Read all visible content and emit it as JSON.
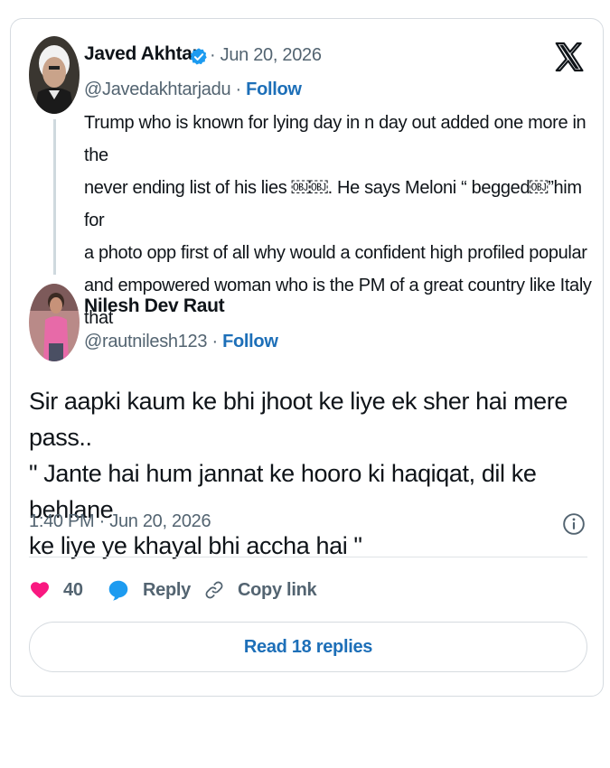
{
  "original_tweet": {
    "author_name": "Javed Akhtar",
    "date": " · Jun 20, 2026",
    "handle": "@Javedakhtarjadu · ",
    "follow_label": "Follow",
    "text": "Trump who is known for lying day in n day out added one more in the\nnever ending list of his lies ￼￼. He says Meloni “ begged￼”him for\na photo opp first of all why would a confident  high profiled popular\nand empowered woman  who is the PM of a great  country like Italy\nthat"
  },
  "reply_tweet": {
    "author_name": "Nilesh Dev Raut",
    "handle": "@rautnilesh123 · ",
    "follow_label": "Follow",
    "text": "Sir aapki kaum ke bhi jhoot ke liye ek sher hai mere pass..\n\" Jante hai hum jannat ke hooro ki haqiqat, dil ke behlane\nke liye ye khayal bhi accha hai \"",
    "timestamp": "1:40 PM · Jun 20, 2026"
  },
  "actions": {
    "like_count": "40",
    "reply_label": "Reply",
    "copy_link_label": "Copy link"
  },
  "read_replies_label": "Read 18 replies",
  "colors": {
    "accent": "#1d9bf0",
    "link": "#1d6fb8",
    "like": "#f91880",
    "muted": "#536471"
  },
  "icons": [
    "x-logo-icon",
    "verified-badge-icon",
    "info-icon",
    "heart-icon",
    "reply-bubble-icon",
    "link-icon"
  ]
}
